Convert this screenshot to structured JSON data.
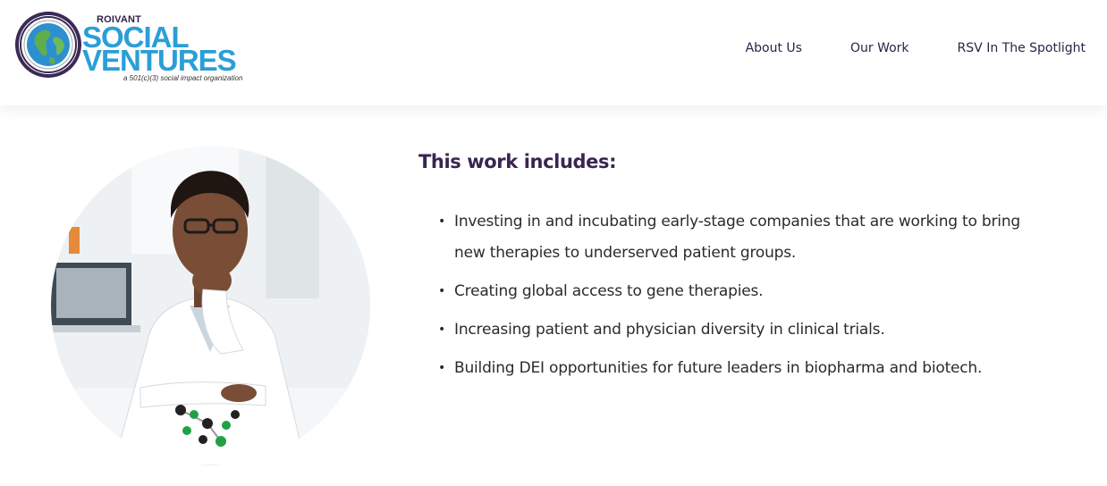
{
  "logo": {
    "top_word": "ROIVANT",
    "line1": "SOCIAL",
    "line2": "VENTURES",
    "tagline": "a 501(c)(3) social impact organization"
  },
  "nav": {
    "items": [
      "About Us",
      "Our Work",
      "RSV In The Spotlight"
    ]
  },
  "main": {
    "heading": "This work includes:",
    "bullets": [
      "Investing in and incubating early-stage companies that are working to bring new therapies to underserved patient groups.",
      "Creating global access to gene therapies.",
      "Increasing patient and physician diversity in clinical trials.",
      "Building DEI opportunities for future leaders in biopharma and biotech."
    ],
    "bullet_marker": "•"
  },
  "colors": {
    "brand_blue": "#2a9fd6",
    "brand_purple": "#2f2246",
    "heading": "#3a2550"
  }
}
